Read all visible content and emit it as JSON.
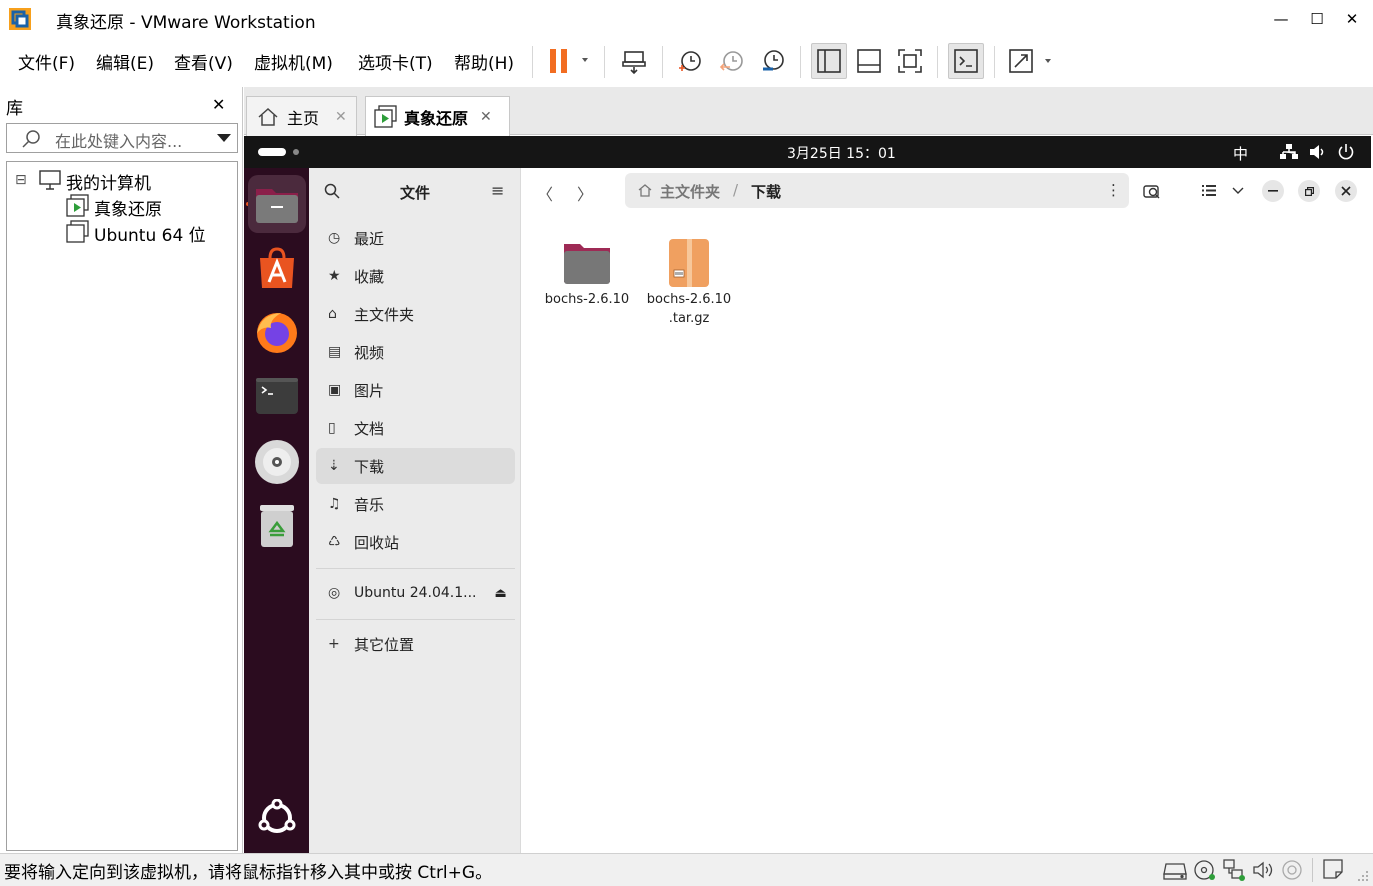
{
  "window": {
    "title": "真象还原 - VMware Workstation",
    "minimize": "—",
    "maximize": "☐",
    "close": "✕"
  },
  "menu": {
    "items": [
      "文件(F)",
      "编辑(E)",
      "查看(V)",
      "虚拟机(M)",
      "选项卡(T)",
      "帮助(H)"
    ]
  },
  "library": {
    "title": "库",
    "close": "✕",
    "search_placeholder": "在此处键入内容...",
    "root": "我的计算机",
    "root_toggle": "⊟",
    "vms": [
      "真象还原",
      "Ubuntu 64 位"
    ]
  },
  "tabs": [
    {
      "label": "主页",
      "icon": "home-icon",
      "close": "✕"
    },
    {
      "label": "真象还原",
      "icon": "vm-running-icon",
      "close": "✕"
    }
  ],
  "guest": {
    "topbar": {
      "datetime": "3月25日  15：01",
      "ime": "中"
    },
    "dock_apps": [
      "files-icon",
      "app-center-icon",
      "firefox-icon",
      "terminal-icon",
      "disc-icon",
      "trash-icon"
    ],
    "files": {
      "sidebar_title": "文件",
      "sidebar_items": [
        {
          "label": "最近",
          "icon": "◷"
        },
        {
          "label": "收藏",
          "icon": "★"
        },
        {
          "label": "主文件夹",
          "icon": "⌂"
        },
        {
          "label": "视频",
          "icon": "▤"
        },
        {
          "label": "图片",
          "icon": "▣"
        },
        {
          "label": "文档",
          "icon": "▯"
        },
        {
          "label": "下载",
          "icon": "⇣"
        },
        {
          "label": "音乐",
          "icon": "♫"
        },
        {
          "label": "回收站",
          "icon": "♺"
        }
      ],
      "selected": "下载",
      "device": "Ubuntu 24.04.1...",
      "device_eject": "⏏",
      "other_places": "其它位置",
      "other_places_icon": "+",
      "path": {
        "home": "主文件夹",
        "sep": "/",
        "current": "下载"
      },
      "back": "〈",
      "forward": "〉",
      "menu_dots": "⋮",
      "items": [
        {
          "name_line1": "bochs-2.6.10",
          "name_line2": "",
          "kind": "folder"
        },
        {
          "name_line1": "bochs-2.6.10",
          "name_line2": ".tar.gz",
          "kind": "archive"
        }
      ]
    }
  },
  "status": {
    "text": "要将输入定向到该虚拟机，请将鼠标指针移入其中或按 Ctrl+G。"
  },
  "colors": {
    "accent_orange": "#e95420",
    "dock_bg": "#2b0c1f",
    "topbar_bg": "#151515",
    "pause_orange": "#f26d21"
  }
}
